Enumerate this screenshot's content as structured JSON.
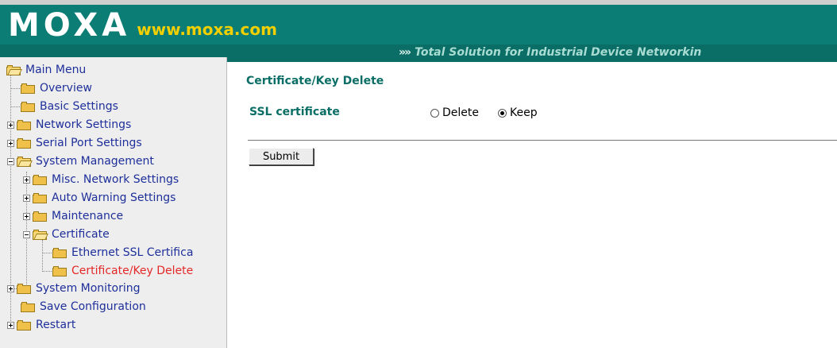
{
  "header": {
    "logo_text": "MOXA",
    "logo_url": "www.moxa.com",
    "tagline_arrows": "»»",
    "tagline": "Total Solution for Industrial Device Networkin",
    "colors": {
      "header_bg": "#0c7d74",
      "url_text": "#f2d000"
    }
  },
  "sidebar": {
    "items": [
      {
        "label": "Main Menu",
        "icon": "folder-open-icon"
      },
      {
        "label": "Overview",
        "icon": "folder-icon"
      },
      {
        "label": "Basic Settings",
        "icon": "folder-icon"
      },
      {
        "label": "Network Settings",
        "icon": "folder-icon",
        "expander": "plus"
      },
      {
        "label": "Serial Port Settings",
        "icon": "folder-icon",
        "expander": "plus"
      },
      {
        "label": "System Management",
        "icon": "folder-open-icon",
        "expander": "minus"
      },
      {
        "label": "Misc. Network Settings",
        "icon": "folder-icon",
        "expander": "plus"
      },
      {
        "label": "Auto Warning Settings",
        "icon": "folder-icon",
        "expander": "plus"
      },
      {
        "label": "Maintenance",
        "icon": "folder-icon",
        "expander": "plus"
      },
      {
        "label": "Certificate",
        "icon": "folder-open-icon",
        "expander": "minus"
      },
      {
        "label": "Ethernet SSL Certifica",
        "icon": "folder-icon"
      },
      {
        "label": "Certificate/Key Delete",
        "icon": "folder-icon",
        "selected": true
      },
      {
        "label": "System Monitoring",
        "icon": "folder-icon",
        "expander": "plus"
      },
      {
        "label": "Save Configuration",
        "icon": "folder-icon"
      },
      {
        "label": "Restart",
        "icon": "folder-icon",
        "expander": "plus"
      }
    ]
  },
  "main": {
    "section_title": "Certificate/Key Delete",
    "ssl_label": "SSL certificate",
    "options": [
      {
        "label": "Delete",
        "checked": false
      },
      {
        "label": "Keep",
        "checked": true
      }
    ],
    "submit_label": "Submit"
  }
}
